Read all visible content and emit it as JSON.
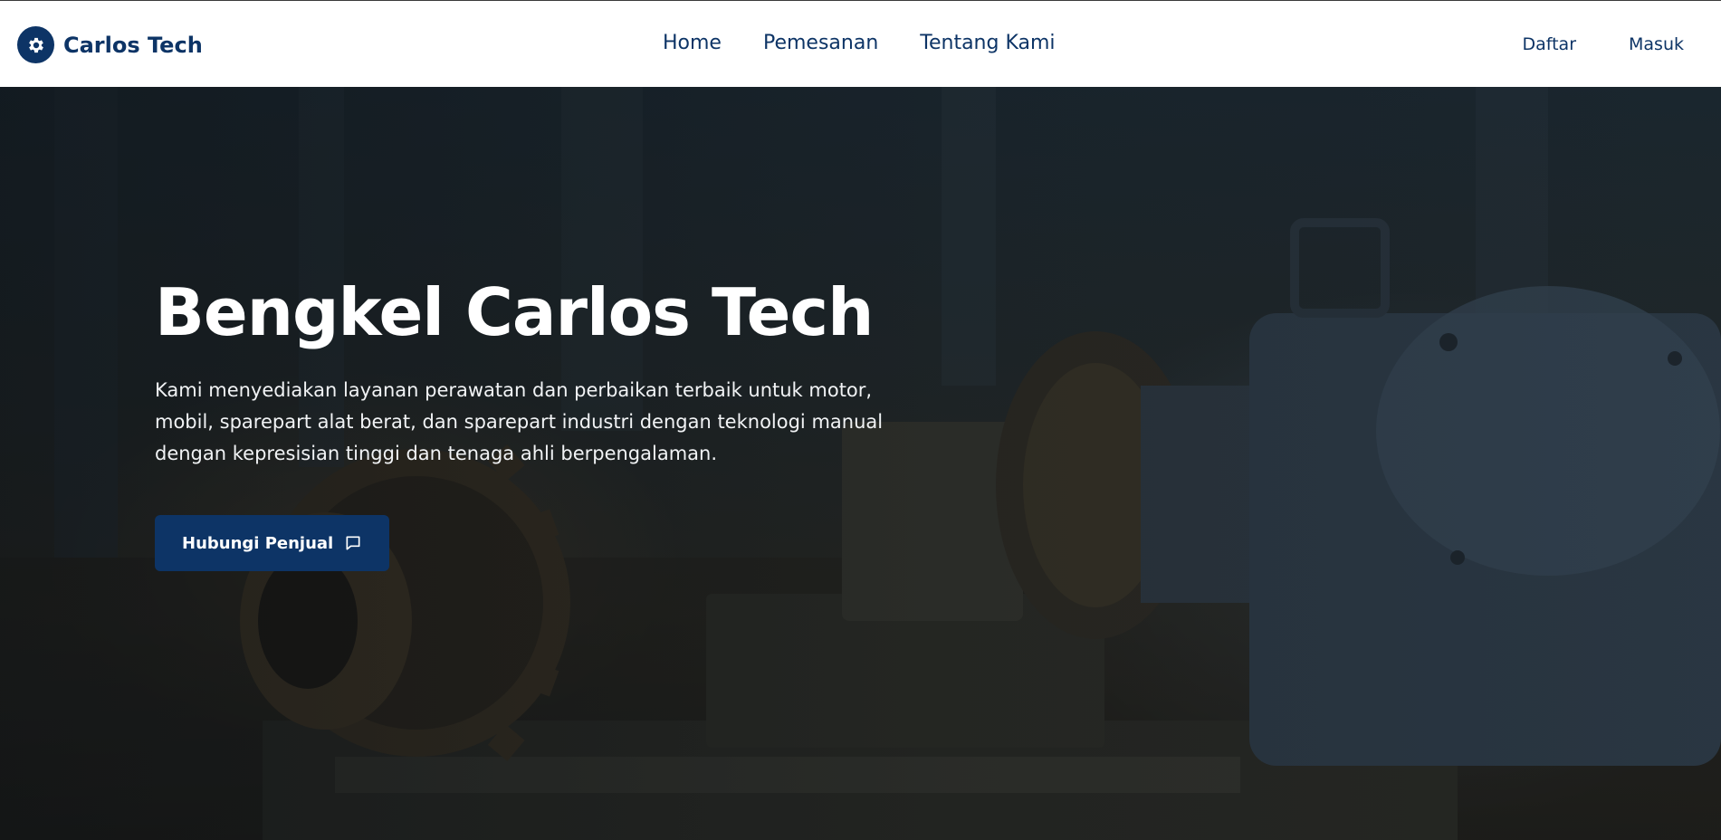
{
  "header": {
    "brand": {
      "name": "Carlos Tech",
      "icon": "gear-icon"
    },
    "nav": [
      {
        "label": "Home"
      },
      {
        "label": "Pemesanan"
      },
      {
        "label": "Tentang Kami"
      }
    ],
    "auth": {
      "register_label": "Daftar",
      "login_label": "Masuk"
    }
  },
  "hero": {
    "title": "Bengkel Carlos Tech",
    "description": "Kami menyediakan layanan perawatan dan perbaikan terbaik untuk motor, mobil, sparepart alat berat, dan sparepart industri dengan teknologi manual dengan kepresisian tinggi dan tenaga ahli berpengalaman.",
    "cta": {
      "label": "Hubungi Penjual",
      "icon": "chat-icon"
    }
  },
  "colors": {
    "brand": "#0d3466",
    "header_bg": "#ffffff",
    "hero_text": "#ffffff"
  }
}
